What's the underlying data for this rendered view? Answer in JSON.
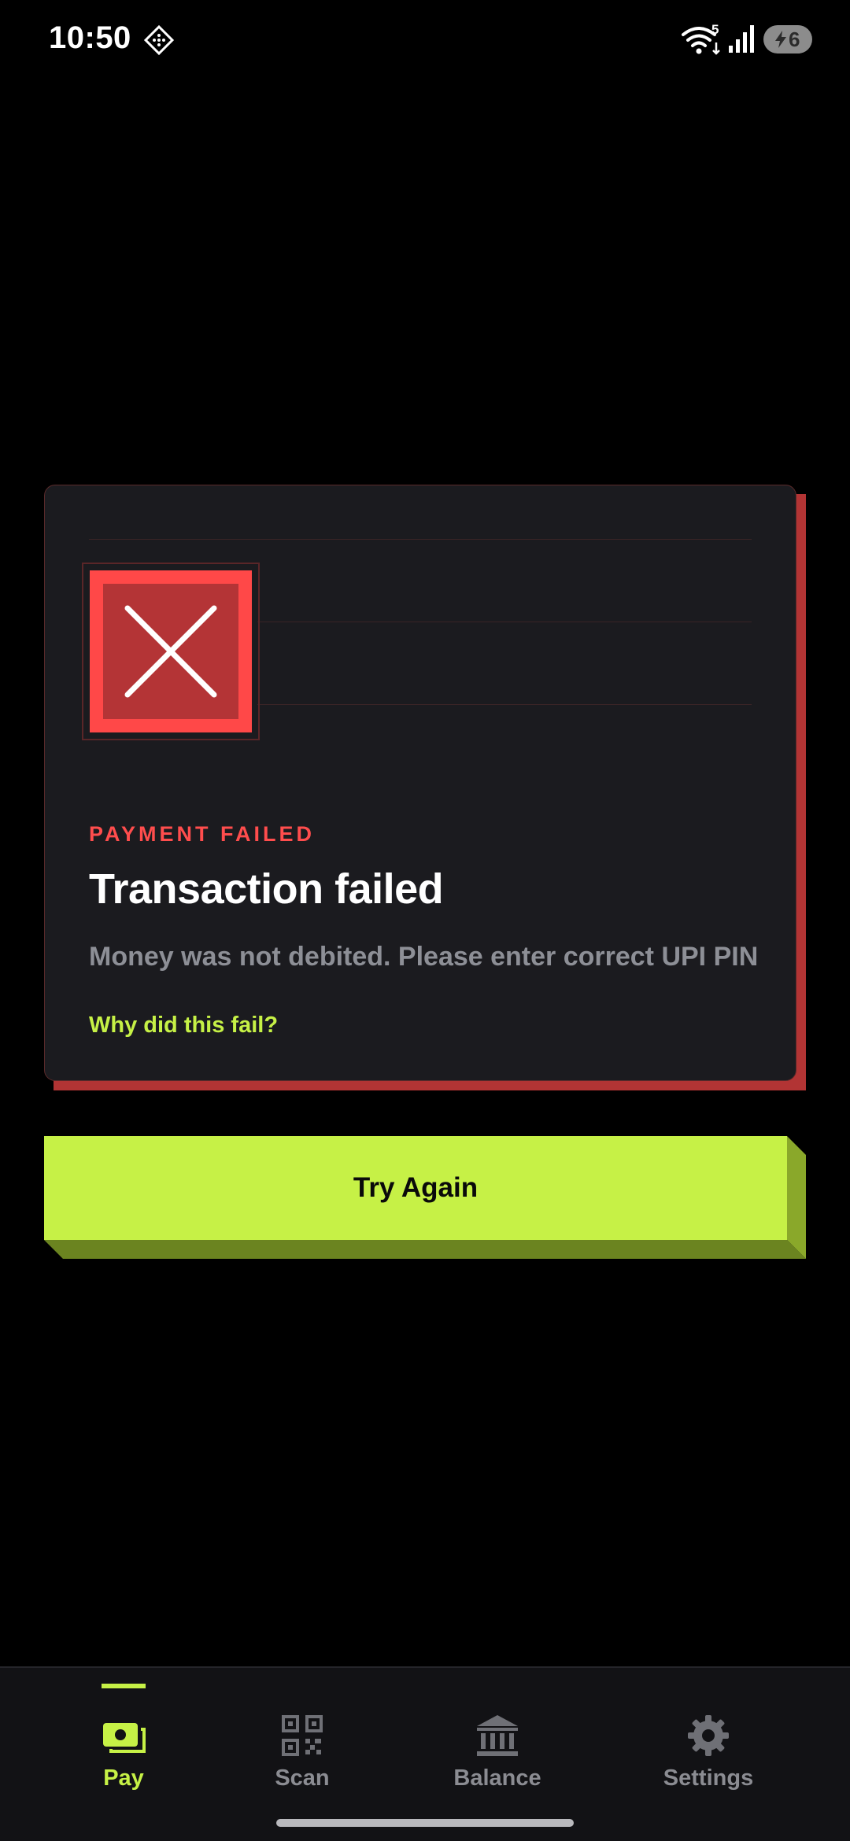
{
  "status_bar": {
    "time": "10:50",
    "wifi_label": "5",
    "battery_level": "6",
    "icons": [
      "app-notification-icon",
      "wifi-icon",
      "cell-signal-icon",
      "battery-charging-icon"
    ]
  },
  "card": {
    "status_icon": "error-x-icon",
    "eyebrow": "PAYMENT FAILED",
    "title": "Transaction failed",
    "message": "Money was not debited. Please enter correct UPI PIN",
    "help_link": "Why did this fail?"
  },
  "actions": {
    "retry_label": "Try Again"
  },
  "bottom_nav": {
    "items": [
      {
        "label": "Pay",
        "icon": "wallet-icon",
        "active": true
      },
      {
        "label": "Scan",
        "icon": "qr-code-icon",
        "active": false
      },
      {
        "label": "Balance",
        "icon": "bank-icon",
        "active": false
      },
      {
        "label": "Settings",
        "icon": "gear-icon",
        "active": false
      }
    ]
  },
  "colors": {
    "background": "#000000",
    "card": "#1b1b1f",
    "error": "#ff4848",
    "error_dark": "#b43436",
    "accent": "#c6f146",
    "muted_text": "#8d8f96"
  }
}
